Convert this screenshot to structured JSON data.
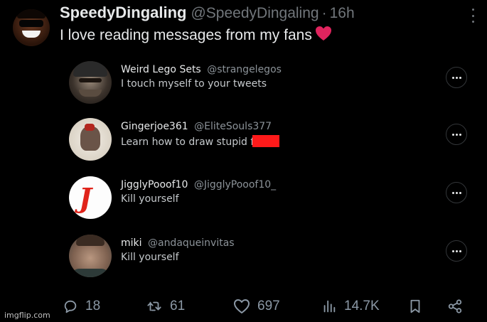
{
  "tweet": {
    "display_name": "SpeedyDingaling",
    "handle": "@SpeedyDingaling",
    "separator": "·",
    "time": "16h",
    "text": "I love reading messages from my fans",
    "emoji": "heart"
  },
  "replies": [
    {
      "name": "Weird Lego Sets",
      "handle": "@strangelegos",
      "text": "I touch myself to your tweets"
    },
    {
      "name": "Gingerjoe361",
      "handle": "@EliteSouls377",
      "text": "Learn how to draw stupid f"
    },
    {
      "name": "JigglyPooof10",
      "handle": "@JigglyPooof10_",
      "text": "Kill yourself"
    },
    {
      "name": "miki",
      "handle": "@andaqueinvitas",
      "text": "Kill yourself"
    }
  ],
  "actions": {
    "replies": "18",
    "retweets": "61",
    "likes": "697",
    "views": "14.7K"
  },
  "colors": {
    "accent_red": "#ff1a1a",
    "heart": "#e0245e",
    "muted": "#71767b"
  },
  "watermark": "imgflip.com"
}
